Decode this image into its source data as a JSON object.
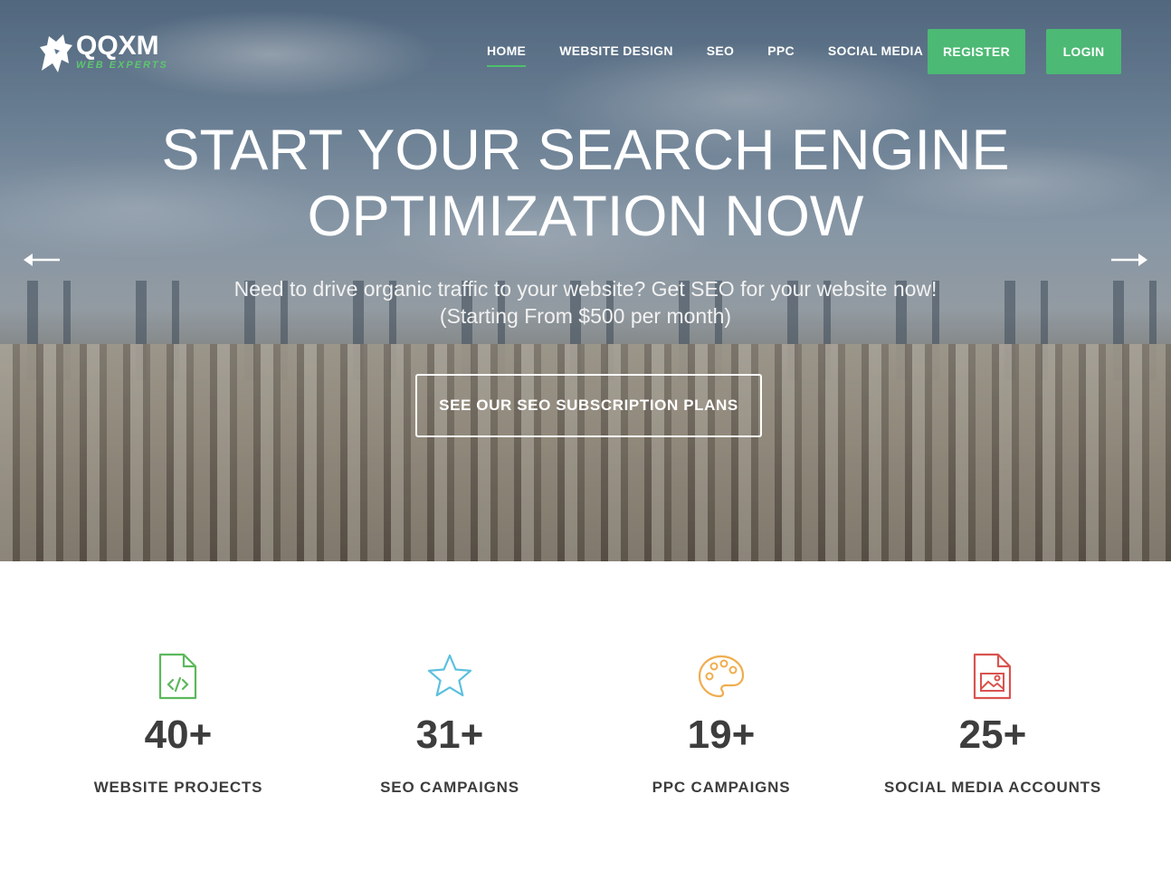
{
  "brand": {
    "name": "QQXM",
    "tagline": "WEB EXPERTS",
    "accent": "#4cb974"
  },
  "nav": {
    "items": [
      {
        "label": "HOME",
        "active": true
      },
      {
        "label": "WEBSITE DESIGN",
        "active": false
      },
      {
        "label": "SEO",
        "active": false
      },
      {
        "label": "PPC",
        "active": false
      },
      {
        "label": "SOCIAL MEDIA",
        "active": false
      }
    ],
    "register_label": "REGISTER",
    "login_label": "LOGIN"
  },
  "hero": {
    "title_line1": "START YOUR SEARCH ENGINE",
    "title_line2": "OPTIMIZATION NOW",
    "subtitle_line1": "Need to drive organic traffic to your website? Get SEO for your website now!",
    "subtitle_line2": "(Starting From $500 per month)",
    "cta_label": "SEE OUR SEO SUBSCRIPTION PLANS",
    "prev_icon": "arrow-left-icon",
    "next_icon": "arrow-right-icon"
  },
  "stats": [
    {
      "icon": "code-file-icon",
      "color": "#5cb85c",
      "value": "40+",
      "label": "WEBSITE PROJECTS"
    },
    {
      "icon": "star-icon",
      "color": "#5bc0de",
      "value": "31+",
      "label": "SEO CAMPAIGNS"
    },
    {
      "icon": "palette-icon",
      "color": "#f0ad4e",
      "value": "19+",
      "label": "PPC CAMPAIGNS"
    },
    {
      "icon": "image-file-icon",
      "color": "#d9534f",
      "value": "25+",
      "label": "SOCIAL MEDIA ACCOUNTS"
    }
  ]
}
